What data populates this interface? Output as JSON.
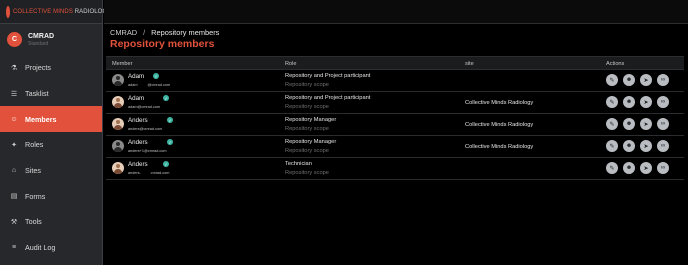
{
  "brand": {
    "part1": "COLLECTIVE MINDS",
    "part2": "RADIOLOGY"
  },
  "profile": {
    "initial": "C",
    "name": "CMRAD",
    "subtitle": "Standard"
  },
  "nav": [
    {
      "label": "Projects",
      "icon": "flask-icon",
      "glyph": "⚗"
    },
    {
      "label": "Tasklist",
      "icon": "tasklist-icon",
      "glyph": "☰"
    },
    {
      "label": "Members",
      "icon": "members-icon",
      "glyph": "☺",
      "active": true
    },
    {
      "label": "Roles",
      "icon": "roles-icon",
      "glyph": "✦"
    },
    {
      "label": "Sites",
      "icon": "sites-icon",
      "glyph": "⌂"
    },
    {
      "label": "Forms",
      "icon": "forms-icon",
      "glyph": "▤"
    },
    {
      "label": "Tools",
      "icon": "tools-icon",
      "glyph": "⚒"
    },
    {
      "label": "Audit Log",
      "icon": "audit-log-icon",
      "glyph": "≡"
    }
  ],
  "breadcrumb": {
    "root": "CMRAD",
    "separator": "/",
    "current": "Repository members"
  },
  "page_title": "Repository members",
  "table": {
    "headers": {
      "member": "Member",
      "role": "Role",
      "site": "site",
      "actions": "Actions"
    },
    "rows": [
      {
        "name": "Adam",
        "email": "adam",
        "email2": "@cmrad.com",
        "role": "Repository and Project participant",
        "scope": "Repository scope",
        "site": "",
        "avatar": "generic"
      },
      {
        "name": "Adam",
        "email": "adam@cmrad.com",
        "email2": "",
        "role": "Repository and Project participant",
        "scope": "Repository scope",
        "site": "Collective Minds Radiology",
        "avatar": "photo"
      },
      {
        "name": "Anders",
        "email": "anders@cmrad.com",
        "email2": "",
        "role": "Repository Manager",
        "scope": "Repository scope",
        "site": "Collective Minds Radiology",
        "avatar": "photo"
      },
      {
        "name": "Anders",
        "email": "anders+1@cmrad.com",
        "email2": "",
        "role": "Repository Manager",
        "scope": "Repository scope",
        "site": "Collective Minds Radiology",
        "avatar": "generic"
      },
      {
        "name": "Anders",
        "email": "anders.",
        "email2": "cmrad.com",
        "role": "Technician",
        "scope": "Repository scope",
        "site": "",
        "avatar": "photo"
      }
    ]
  },
  "actions": [
    {
      "name": "edit-icon",
      "glyph": "✎"
    },
    {
      "name": "user-icon",
      "glyph": "☻"
    },
    {
      "name": "send-icon",
      "glyph": "➤"
    },
    {
      "name": "link-icon",
      "glyph": "∞"
    }
  ],
  "colors": {
    "accent": "#e2513b",
    "verified": "#3fb6a4",
    "sidebar": "#26282b"
  }
}
